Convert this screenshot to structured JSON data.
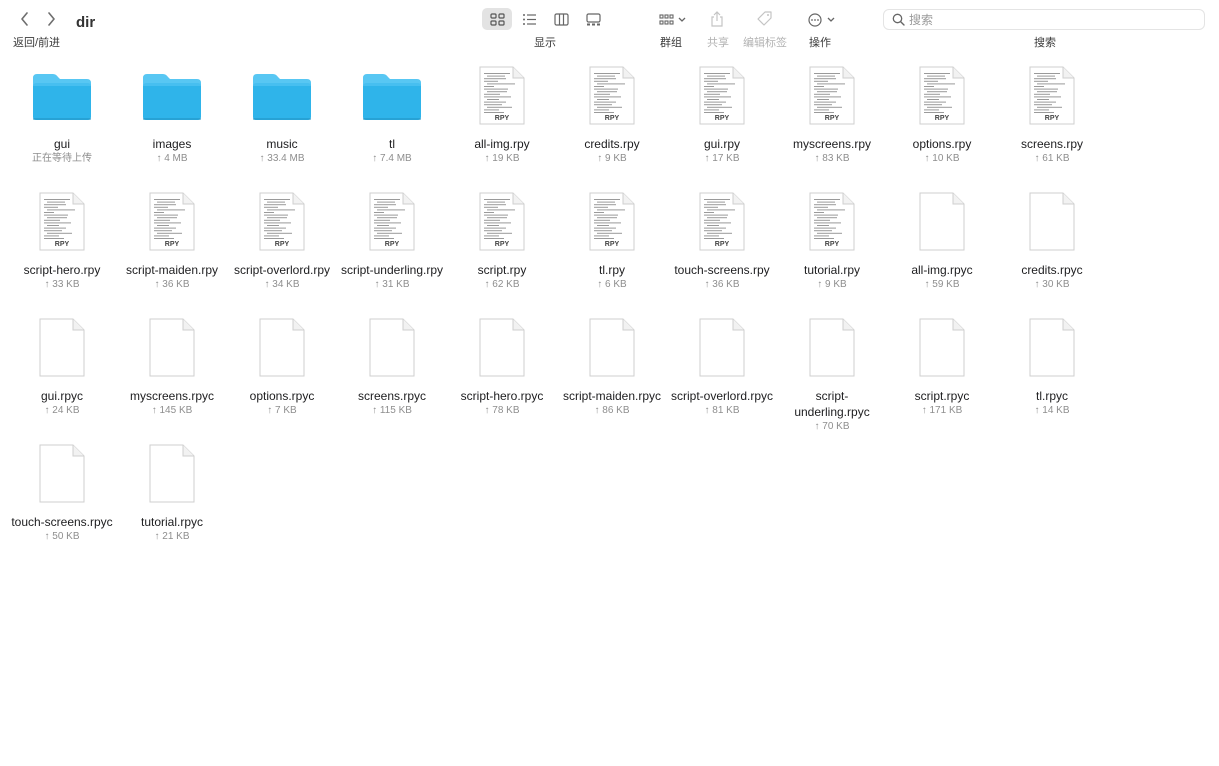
{
  "window": {
    "title": "dir"
  },
  "toolbar": {
    "nav_caption": "返回/前进",
    "view_caption": "显示",
    "group_caption": "群组",
    "share_caption": "共享",
    "tags_caption": "编辑标签",
    "action_caption": "操作",
    "search_caption": "搜索",
    "search_placeholder": "搜索",
    "search_value": ""
  },
  "colors": {
    "folder_blue": "#2fb4ea",
    "folder_tab": "#58c7f3",
    "doc_gray": "#f2f2f2"
  },
  "files": [
    {
      "name": "gui",
      "status": "正在等待上传",
      "kind": "folder"
    },
    {
      "name": "images",
      "status": "↑ 4 MB",
      "kind": "folder"
    },
    {
      "name": "music",
      "status": "↑ 33.4 MB",
      "kind": "folder"
    },
    {
      "name": "tl",
      "status": "↑ 7.4 MB",
      "kind": "folder"
    },
    {
      "name": "all-img.rpy",
      "status": "↑ 19 KB",
      "kind": "rpy",
      "badge": "RPY"
    },
    {
      "name": "credits.rpy",
      "status": "↑ 9 KB",
      "kind": "rpy",
      "badge": "RPY"
    },
    {
      "name": "gui.rpy",
      "status": "↑ 17 KB",
      "kind": "rpy",
      "badge": "RPY"
    },
    {
      "name": "myscreens.rpy",
      "status": "↑ 83 KB",
      "kind": "rpy",
      "badge": "RPY"
    },
    {
      "name": "options.rpy",
      "status": "↑ 10 KB",
      "kind": "rpy",
      "badge": "RPY"
    },
    {
      "name": "screens.rpy",
      "status": "↑ 61 KB",
      "kind": "rpy",
      "badge": "RPY"
    },
    {
      "name": "script-hero.rpy",
      "status": "↑ 33 KB",
      "kind": "rpy",
      "badge": "RPY"
    },
    {
      "name": "script-maiden.rpy",
      "status": "↑ 36 KB",
      "kind": "rpy",
      "badge": "RPY"
    },
    {
      "name": "script-overlord.rpy",
      "status": "↑ 34 KB",
      "kind": "rpy",
      "badge": "RPY"
    },
    {
      "name": "script-underling.rpy",
      "status": "↑ 31 KB",
      "kind": "rpy",
      "badge": "RPY"
    },
    {
      "name": "script.rpy",
      "status": "↑ 62 KB",
      "kind": "rpy",
      "badge": "RPY"
    },
    {
      "name": "tl.rpy",
      "status": "↑ 6 KB",
      "kind": "rpy",
      "badge": "RPY"
    },
    {
      "name": "touch-screens.rpy",
      "status": "↑ 36 KB",
      "kind": "rpy",
      "badge": "RPY"
    },
    {
      "name": "tutorial.rpy",
      "status": "↑ 9 KB",
      "kind": "rpy",
      "badge": "RPY"
    },
    {
      "name": "all-img.rpyc",
      "status": "↑ 59 KB",
      "kind": "blank"
    },
    {
      "name": "credits.rpyc",
      "status": "↑ 30 KB",
      "kind": "blank"
    },
    {
      "name": "gui.rpyc",
      "status": "↑ 24 KB",
      "kind": "blank"
    },
    {
      "name": "myscreens.rpyc",
      "status": "↑ 145 KB",
      "kind": "blank"
    },
    {
      "name": "options.rpyc",
      "status": "↑ 7 KB",
      "kind": "blank"
    },
    {
      "name": "screens.rpyc",
      "status": "↑ 115 KB",
      "kind": "blank"
    },
    {
      "name": "script-hero.rpyc",
      "status": "↑ 78 KB",
      "kind": "blank"
    },
    {
      "name": "script-maiden.rpyc",
      "status": "↑ 86 KB",
      "kind": "blank"
    },
    {
      "name": "script-overlord.rpyc",
      "status": "↑ 81 KB",
      "kind": "blank"
    },
    {
      "name": "script-underling.rpyc",
      "status": "↑ 70 KB",
      "kind": "blank"
    },
    {
      "name": "script.rpyc",
      "status": "↑ 171 KB",
      "kind": "blank"
    },
    {
      "name": "tl.rpyc",
      "status": "↑ 14 KB",
      "kind": "blank"
    },
    {
      "name": "touch-screens.rpyc",
      "status": "↑ 50 KB",
      "kind": "blank"
    },
    {
      "name": "tutorial.rpyc",
      "status": "↑ 21 KB",
      "kind": "blank"
    }
  ]
}
